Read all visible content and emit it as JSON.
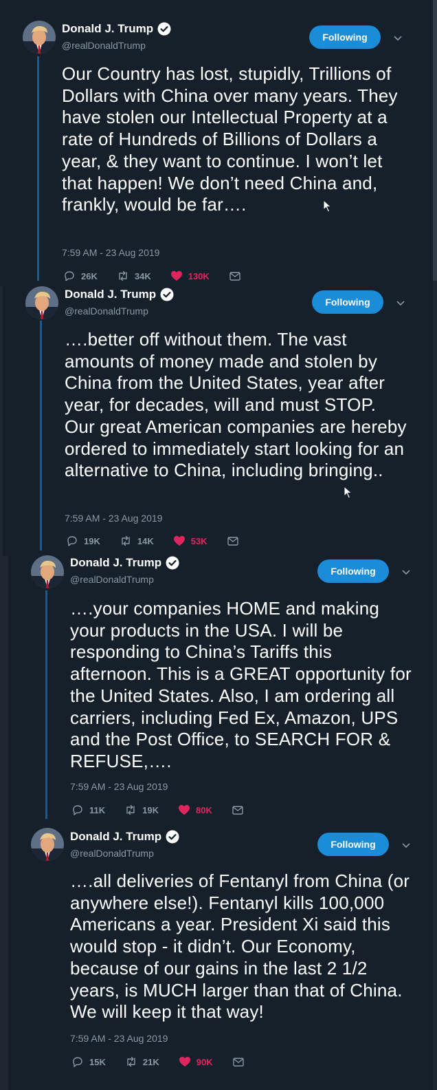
{
  "colors": {
    "page_bg": "#1e2732",
    "card_bg": "#15202b",
    "accent": "#1b8cd8",
    "like": "#e0245e",
    "muted": "#8899a6"
  },
  "tweets": [
    {
      "name": "Donald J. Trump",
      "handle": "@realDonaldTrump",
      "follow_label": "Following",
      "text": "Our Country has lost, stupidly, Trillions of Dollars with China over many years. They have stolen our Intellectual Property at a rate of Hundreds of Billions of Dollars a year, & they want to continue. I won’t let that happen! We don’t need China and, frankly, would be far….",
      "timestamp": "7:59 AM - 23 Aug 2019",
      "replies": "26K",
      "retweets": "34K",
      "likes": "130K"
    },
    {
      "name": "Donald J. Trump",
      "handle": "@realDonaldTrump",
      "follow_label": "Following",
      "text": "….better off without them. The vast amounts of money made and stolen by China from the United States, year after year, for decades, will and must STOP. Our great American companies are hereby ordered to immediately start looking for an alternative to China, including bringing..",
      "timestamp": "7:59 AM - 23 Aug 2019",
      "replies": "19K",
      "retweets": "14K",
      "likes": "53K"
    },
    {
      "name": "Donald J. Trump",
      "handle": "@realDonaldTrump",
      "follow_label": "Following",
      "text": "….your companies HOME and making your products in the USA. I will be responding to China’s Tariffs this afternoon. This is a GREAT opportunity for the United States. Also, I am ordering all carriers, including Fed Ex, Amazon, UPS and the Post Office, to SEARCH FOR & REFUSE,….",
      "timestamp": "7:59 AM - 23 Aug 2019",
      "replies": "11K",
      "retweets": "19K",
      "likes": "80K"
    },
    {
      "name": "Donald J. Trump",
      "handle": "@realDonaldTrump",
      "follow_label": "Following",
      "text": "….all deliveries of Fentanyl from China (or anywhere else!). Fentanyl kills 100,000 Americans a year. President Xi said this would stop - it didn’t. Our Economy, because of our gains in the last 2 1/2 years, is MUCH larger than that of China. We will keep it that way!",
      "timestamp": "7:59 AM - 23 Aug 2019",
      "replies": "15K",
      "retweets": "21K",
      "likes": "90K"
    }
  ]
}
